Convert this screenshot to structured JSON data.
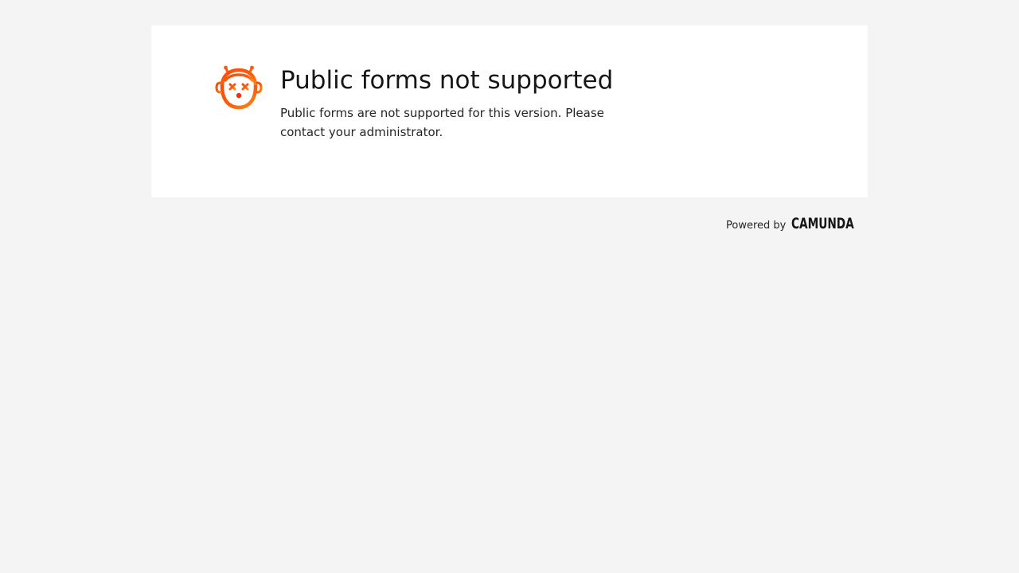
{
  "error": {
    "title": "Public forms not supported",
    "message": "Public forms are not supported for this version. Please contact your administrator.",
    "icon": "robot-error-icon",
    "accent_colors": [
      "#fc5d0d",
      "#f1310b"
    ]
  },
  "footer": {
    "powered_by": "Powered by",
    "brand": "CAMUNDA"
  },
  "colors": {
    "page_background": "#f4f4f4",
    "card_background": "#ffffff",
    "text": "#161616"
  }
}
